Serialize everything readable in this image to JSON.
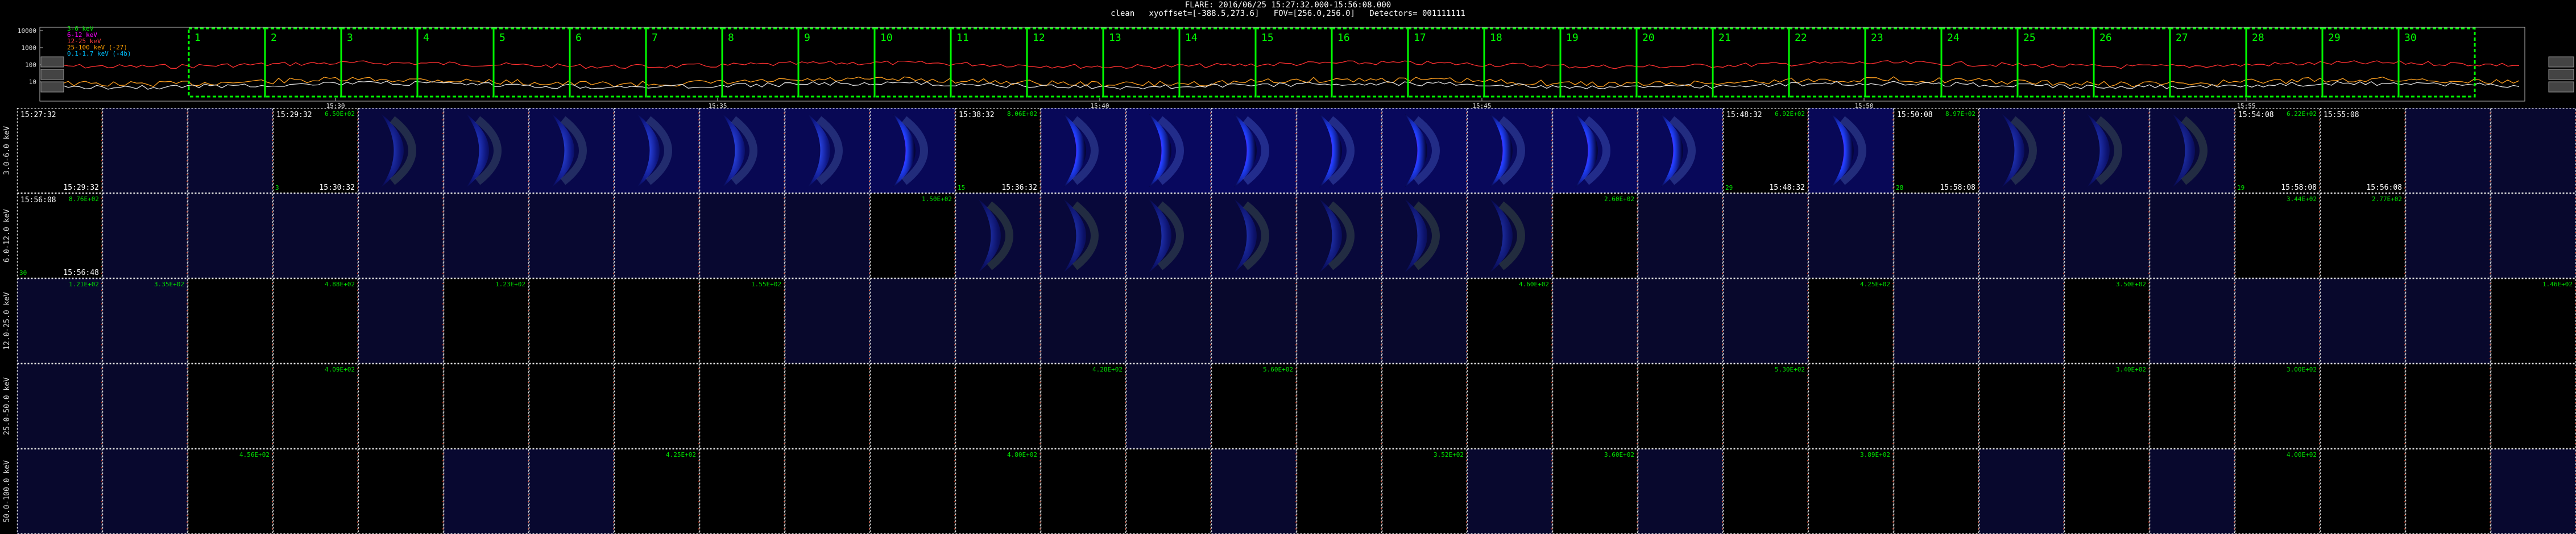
{
  "header": {
    "line1": "FLARE: 2016/06/25 15:27:32.000-15:56:08.000",
    "line2": "clean   xyoffset=[-388.5,273.6]   FOV=[256.0,256.0]   Detectors= 001111111"
  },
  "lightcurve": {
    "legend": [
      {
        "label": "3-6 keV",
        "color": "#00e000"
      },
      {
        "label": "6-12 keV",
        "color": "#ff00ff"
      },
      {
        "label": "12-25 keV",
        "color": "#ff4040"
      },
      {
        "label": "25-100 keV (-27)",
        "color": "#ffa000"
      },
      {
        "label": "0.1-1.7 keV (-4b)",
        "color": "#00c0ff"
      }
    ],
    "y_ticks": [
      "10000",
      "1000",
      "100",
      "10"
    ],
    "x_ticks": [
      "15:30",
      "15:35",
      "15:40",
      "15:45",
      "15:50",
      "15:55"
    ],
    "intervals": [
      "1",
      "2",
      "3",
      "4",
      "5",
      "6",
      "7",
      "8",
      "9",
      "10",
      "11",
      "12",
      "13",
      "14",
      "15",
      "16",
      "17",
      "18",
      "19",
      "20",
      "21",
      "22",
      "23",
      "24",
      "25",
      "26",
      "27",
      "28",
      "29",
      "30"
    ],
    "colors": {
      "interval_box": "#00ff00",
      "curve_high": "#ff3030",
      "curve_mid": "#ffa020",
      "curve_low": "#e0e0e0"
    }
  },
  "grid": {
    "row_labels": [
      "3.0-6.0 keV",
      "6.0-12.0 keV",
      "12.0-25.0 keV",
      "25.0-50.0 keV",
      "50.0-100.0 keV"
    ],
    "cells": [
      [
        {
          "i": 0,
          "t": "15:27:32",
          "b": "15:29:32"
        },
        {
          "i": 1,
          "img": 1,
          "int": 10
        },
        {
          "i": 2,
          "img": 1,
          "int": 14
        },
        {
          "i": 3,
          "t": "15:29:32",
          "b": "15:30:32",
          "p": "6.50E+02",
          "n": "3"
        },
        {
          "i": 4,
          "img": 1,
          "int": 36
        },
        {
          "i": 5,
          "img": 1,
          "int": 48
        },
        {
          "i": 6,
          "img": 1,
          "int": 58
        },
        {
          "i": 7,
          "img": 1,
          "int": 66
        },
        {
          "i": 8,
          "img": 1,
          "int": 70
        },
        {
          "i": 9,
          "img": 1,
          "int": 74
        },
        {
          "i": 10,
          "img": 1,
          "int": 78
        },
        {
          "i": 11,
          "t": "15:38:32",
          "b": "15:36:32",
          "p": "8.06E+02",
          "n": "15"
        },
        {
          "i": 12,
          "img": 1,
          "int": 80
        },
        {
          "i": 13,
          "img": 1,
          "int": 90
        },
        {
          "i": 14,
          "img": 1,
          "int": 92
        },
        {
          "i": 15,
          "img": 1,
          "int": 88
        },
        {
          "i": 16,
          "img": 1,
          "int": 86
        },
        {
          "i": 17,
          "img": 1,
          "int": 84
        },
        {
          "i": 18,
          "img": 1,
          "int": 90
        },
        {
          "i": 19,
          "img": 1,
          "int": 82
        },
        {
          "i": 20,
          "t": "15:48:32",
          "b": "15:48:32",
          "p": "6.92E+02",
          "n": "29"
        },
        {
          "i": 21,
          "img": 1,
          "int": 78
        },
        {
          "i": 22,
          "t": "15:50:08",
          "b": "15:58:08",
          "p": "8.97E+02",
          "n": "28"
        },
        {
          "i": 23,
          "img": 1,
          "int": 40
        },
        {
          "i": 24,
          "img": 1,
          "int": 36
        },
        {
          "i": 25,
          "img": 1,
          "int": 30
        },
        {
          "i": 26,
          "t": "15:54:08",
          "b": "15:58:08",
          "p": "6.22E+02",
          "n": "19"
        },
        {
          "i": 27,
          "t": "15:55:08",
          "b": "15:56:08"
        },
        {
          "i": 28,
          "img": 1,
          "int": 18
        },
        {
          "i": 29,
          "img": 1,
          "int": 12
        }
      ],
      [
        {
          "i": 0,
          "t": "15:56:08",
          "b": "15:56:48",
          "p": "8.76E+02",
          "n": "30"
        },
        {
          "i": 1,
          "img": 1,
          "int": 8
        },
        {
          "i": 2,
          "img": 1,
          "int": 8
        },
        {
          "i": 3,
          "img": 1,
          "int": 8
        },
        {
          "i": 4,
          "img": 1,
          "int": 10
        },
        {
          "i": 5,
          "img": 1,
          "int": 12
        },
        {
          "i": 6,
          "img": 1,
          "int": 14
        },
        {
          "i": 7,
          "img": 1,
          "int": 16
        },
        {
          "i": 8,
          "img": 1,
          "int": 14
        },
        {
          "i": 9,
          "img": 1,
          "int": 12
        },
        {
          "i": 10,
          "p": "1.50E+02"
        },
        {
          "i": 11,
          "img": 1,
          "int": 26
        },
        {
          "i": 12,
          "img": 1,
          "int": 30
        },
        {
          "i": 13,
          "img": 1,
          "int": 34
        },
        {
          "i": 14,
          "img": 1,
          "int": 32
        },
        {
          "i": 15,
          "img": 1,
          "int": 30
        },
        {
          "i": 16,
          "img": 1,
          "int": 28
        },
        {
          "i": 17,
          "img": 1,
          "int": 26
        },
        {
          "i": 18,
          "p": "2.60E+02"
        },
        {
          "i": 19,
          "img": 1,
          "int": 8
        },
        {
          "i": 20,
          "img": 1,
          "int": 8
        },
        {
          "i": 21,
          "img": 1,
          "int": 8
        },
        {
          "i": 22,
          "img": 1,
          "int": 8
        },
        {
          "i": 23,
          "img": 1,
          "int": 8
        },
        {
          "i": 24,
          "img": 1,
          "int": 8
        },
        {
          "i": 25,
          "img": 1,
          "int": 8
        },
        {
          "i": 26,
          "p": "3.44E+02"
        },
        {
          "i": 27,
          "p": "2.77E+02"
        },
        {
          "i": 28,
          "img": 1,
          "int": 8
        },
        {
          "i": 29,
          "img": 1,
          "int": 8
        }
      ],
      [
        {
          "i": 0,
          "img": 1,
          "int": 6,
          "p": "1.21E+02"
        },
        {
          "i": 1,
          "img": 1,
          "int": 6,
          "p": "3.35E+02"
        },
        {
          "i": 2
        },
        {
          "i": 3,
          "p": "4.88E+02"
        },
        {
          "i": 4,
          "img": 1,
          "int": 6
        },
        {
          "i": 5,
          "p": "1.23E+02"
        },
        {
          "i": 6
        },
        {
          "i": 7
        },
        {
          "i": 8,
          "p": "1.55E+02"
        },
        {
          "i": 9,
          "img": 1,
          "int": 6
        },
        {
          "i": 10,
          "img": 1,
          "int": 6
        },
        {
          "i": 11,
          "img": 1,
          "int": 6
        },
        {
          "i": 12,
          "img": 1,
          "int": 6
        },
        {
          "i": 13,
          "img": 1,
          "int": 6
        },
        {
          "i": 14,
          "img": 1,
          "int": 6
        },
        {
          "i": 15,
          "img": 1,
          "int": 6
        },
        {
          "i": 16,
          "img": 1,
          "int": 6
        },
        {
          "i": 17,
          "p": "4.60E+02"
        },
        {
          "i": 18,
          "img": 1,
          "int": 6
        },
        {
          "i": 19,
          "img": 1,
          "int": 6
        },
        {
          "i": 20,
          "img": 1,
          "int": 6
        },
        {
          "i": 21,
          "p": "4.25E+02"
        },
        {
          "i": 22,
          "img": 1,
          "int": 6
        },
        {
          "i": 23,
          "img": 1,
          "int": 6
        },
        {
          "i": 24,
          "p": "3.50E+02"
        },
        {
          "i": 25,
          "img": 1,
          "int": 6
        },
        {
          "i": 26,
          "img": 1,
          "int": 6
        },
        {
          "i": 27,
          "img": 1,
          "int": 6
        },
        {
          "i": 28,
          "img": 1,
          "int": 6
        },
        {
          "i": 29,
          "p": "1.46E+02"
        }
      ],
      [
        {
          "i": 0,
          "img": 1,
          "int": 5
        },
        {
          "i": 1,
          "img": 1,
          "int": 5
        },
        {
          "i": 2
        },
        {
          "i": 3,
          "p": "4.09E+02"
        },
        {
          "i": 4
        },
        {
          "i": 5
        },
        {
          "i": 6
        },
        {
          "i": 7
        },
        {
          "i": 8
        },
        {
          "i": 9
        },
        {
          "i": 10
        },
        {
          "i": 11
        },
        {
          "i": 12,
          "p": "4.28E+02"
        },
        {
          "i": 13,
          "img": 1,
          "int": 5
        },
        {
          "i": 14,
          "p": "5.60E+02"
        },
        {
          "i": 15
        },
        {
          "i": 16
        },
        {
          "i": 17
        },
        {
          "i": 18
        },
        {
          "i": 19
        },
        {
          "i": 20,
          "p": "5.30E+02"
        },
        {
          "i": 21
        },
        {
          "i": 22
        },
        {
          "i": 23
        },
        {
          "i": 24,
          "p": "3.40E+02"
        },
        {
          "i": 25
        },
        {
          "i": 26,
          "p": "3.00E+02"
        },
        {
          "i": 27
        },
        {
          "i": 28
        },
        {
          "i": 29
        }
      ],
      [
        {
          "i": 0,
          "img": 1,
          "int": 8
        },
        {
          "i": 1,
          "img": 1,
          "int": 10
        },
        {
          "i": 2,
          "p": "4.56E+02"
        },
        {
          "i": 3
        },
        {
          "i": 4
        },
        {
          "i": 5,
          "img": 1,
          "int": 14
        },
        {
          "i": 6,
          "img": 1,
          "int": 12
        },
        {
          "i": 7,
          "p": "4.25E+02"
        },
        {
          "i": 8
        },
        {
          "i": 9
        },
        {
          "i": 10
        },
        {
          "i": 11,
          "p": "4.80E+02"
        },
        {
          "i": 12
        },
        {
          "i": 13
        },
        {
          "i": 14,
          "img": 1,
          "int": 10
        },
        {
          "i": 15
        },
        {
          "i": 16,
          "p": "3.52E+02"
        },
        {
          "i": 17,
          "img": 1,
          "int": 10
        },
        {
          "i": 18,
          "p": "3.60E+02"
        },
        {
          "i": 19,
          "img": 1,
          "int": 8
        },
        {
          "i": 20
        },
        {
          "i": 21,
          "p": "3.89E+02"
        },
        {
          "i": 22
        },
        {
          "i": 23,
          "img": 1,
          "int": 8
        },
        {
          "i": 24
        },
        {
          "i": 25,
          "img": 1,
          "int": 8
        },
        {
          "i": 26,
          "p": "4.00E+02"
        },
        {
          "i": 27
        },
        {
          "i": 28
        },
        {
          "i": 29,
          "img": 1,
          "int": 12
        }
      ]
    ]
  }
}
